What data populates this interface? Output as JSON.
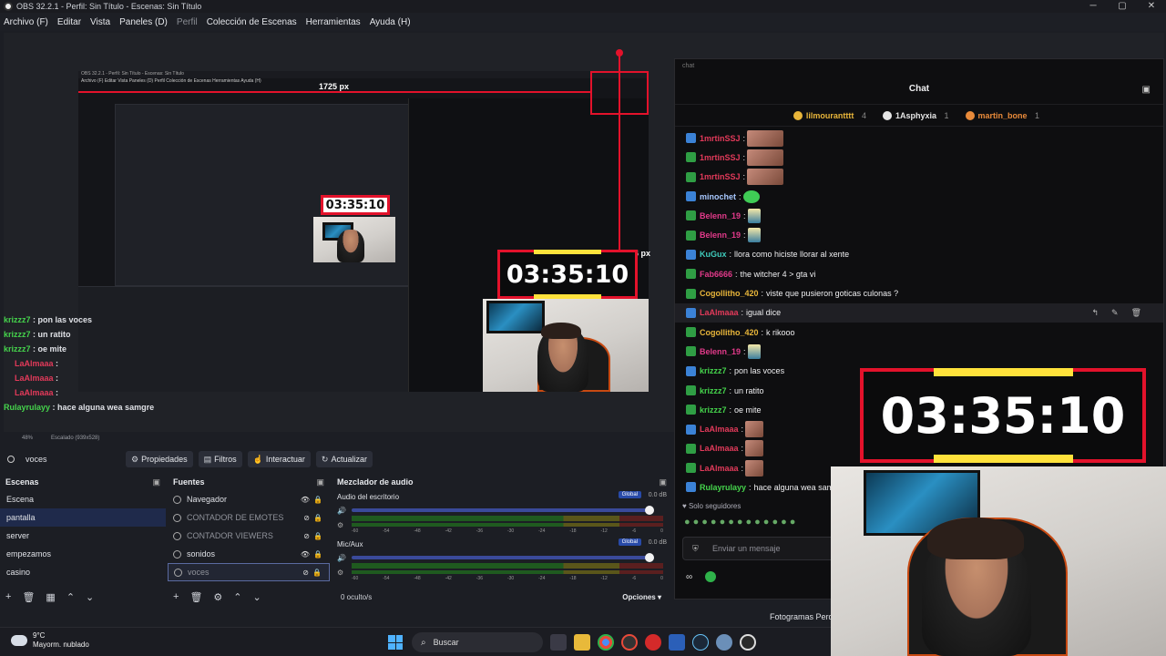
{
  "window": {
    "title": "OBS 32.2.1 - Perfil: Sin Título - Escenas: Sin Título",
    "min": "─",
    "max": "▢",
    "close": "✕"
  },
  "menu": [
    "Archivo (F)",
    "Editar",
    "Vista",
    "Paneles (D)",
    "Perfil",
    "Colección de Escenas",
    "Herramientas",
    "Ayuda (H)"
  ],
  "preview": {
    "width_label": "1725 px",
    "height_label": "934 px",
    "counter": "03:35:10",
    "zoom": "48%",
    "scaled": "Escalado (939x528)",
    "nested_title": "OBS 32.2.1 - Perfil: Sin Título - Escenas: Sin Título",
    "nested_menu": "Archivo (F)  Editar  Vista  Paneles (D)  Perfil  Colección de Escenas  Herramientas  Ayuda (H)",
    "overlay_chat": [
      {
        "user": "krizzz7",
        "text": " : pon las voces",
        "color": "#45d34c"
      },
      {
        "user": "krizzz7",
        "text": " : un ratito",
        "color": "#45d34c"
      },
      {
        "user": "krizzz7",
        "text": " : oe mite",
        "color": "#45d34c"
      },
      {
        "user": "LaAlmaaa",
        "text": " : ",
        "color": "#e23a5a"
      },
      {
        "user": "LaAlmaaa",
        "text": " : ",
        "color": "#e23a5a"
      },
      {
        "user": "LaAlmaaa",
        "text": " : ",
        "color": "#e23a5a"
      },
      {
        "user": "Rulayrulayy",
        "text": " : hace alguna wea samgre",
        "color": "#45d34c"
      }
    ]
  },
  "toolbar": {
    "source_name": "voces",
    "properties": "Propiedades",
    "filters": "Filtros",
    "interact": "Interactuar",
    "refresh": "Actualizar"
  },
  "scenes": {
    "title": "Escenas",
    "items": [
      "Escena",
      "pantalla",
      "server",
      "empezamos",
      "casino"
    ],
    "selected": 1
  },
  "sources": {
    "title": "Fuentes",
    "items": [
      {
        "name": "Navegador",
        "visible": true
      },
      {
        "name": "CONTADOR DE EMOTES",
        "visible": false
      },
      {
        "name": "CONTADOR VIEWERS",
        "visible": false
      },
      {
        "name": "sonidos",
        "visible": true
      },
      {
        "name": "voces",
        "visible": false
      }
    ]
  },
  "mixer": {
    "title": "Mezclador de audio",
    "channels": [
      {
        "name": "Audio del escritorio",
        "global": "Global",
        "db": "0.0 dB"
      },
      {
        "name": "Mic/Aux",
        "global": "Global",
        "db": "0.0 dB"
      }
    ],
    "ticks": [
      "-60",
      "-54",
      "-48",
      "-42",
      "-36",
      "-30",
      "-24",
      "-18",
      "-12",
      "-6",
      "0"
    ],
    "hidden": "0 oculto/s",
    "options": "Opciones"
  },
  "chat": {
    "panel_label": "chat",
    "title": "Chat",
    "leaders": [
      {
        "name": "lilmourantttt",
        "count": "4",
        "color": "#e8b53a"
      },
      {
        "name": "1Asphyxia",
        "count": "1",
        "color": "#e6e6e6"
      },
      {
        "name": "martin_bone",
        "count": "1",
        "color": "#e88a3a"
      }
    ],
    "messages": [
      {
        "user": "1mrtinSSJ",
        "text": "",
        "color": "#e23a5a",
        "emote": "big"
      },
      {
        "user": "1mrtinSSJ",
        "text": "",
        "color": "#e23a5a",
        "emote": "big"
      },
      {
        "user": "1mrtinSSJ",
        "text": "",
        "color": "#e23a5a",
        "emote": "big"
      },
      {
        "user": "minochet",
        "text": "",
        "color": "#a8c8ff",
        "emote": "green"
      },
      {
        "user": "Belenn_19",
        "text": "",
        "color": "#e23a8a",
        "emote": "cat"
      },
      {
        "user": "Belenn_19",
        "text": "",
        "color": "#e23a8a",
        "emote": "cat"
      },
      {
        "user": "KuGux",
        "text": "llora como hiciste llorar al xente",
        "color": "#3fcbbb",
        "emote": ""
      },
      {
        "user": "Fab6666",
        "text": "the witcher 4 > gta vi",
        "color": "#e23a8a",
        "emote": ""
      },
      {
        "user": "Cogollitho_420",
        "text": "viste que pusieron goticas culonas ?",
        "color": "#e8b53a",
        "emote": ""
      },
      {
        "user": "LaAlmaaa",
        "text": "igual dice",
        "color": "#e23a5a",
        "emote": ""
      },
      {
        "user": "Cogollitho_420",
        "text": "k rikooo",
        "color": "#e8b53a",
        "emote": ""
      },
      {
        "user": "Belenn_19",
        "text": "",
        "color": "#e23a8a",
        "emote": "cat"
      },
      {
        "user": "krizzz7",
        "text": "pon las voces",
        "color": "#45d34c",
        "emote": ""
      },
      {
        "user": "krizzz7",
        "text": "un ratito",
        "color": "#45d34c",
        "emote": ""
      },
      {
        "user": "krizzz7",
        "text": "oe mite",
        "color": "#45d34c",
        "emote": ""
      },
      {
        "user": "LaAlmaaa",
        "text": "",
        "color": "#e23a5a",
        "emote": "small"
      },
      {
        "user": "LaAlmaaa",
        "text": "",
        "color": "#e23a5a",
        "emote": "small"
      },
      {
        "user": "LaAlmaaa",
        "text": "",
        "color": "#e23a5a",
        "emote": "small"
      },
      {
        "user": "Rulayrulayy",
        "text": "hace alguna wea samgre",
        "color": "#45d34c",
        "emote": ""
      }
    ],
    "filter": "♥ Solo seguidores",
    "input_placeholder": "Enviar un mensaje",
    "footer": "∞"
  },
  "status": {
    "fps": "Fotogramas Perd"
  },
  "taskbar": {
    "temp": "9°C",
    "weather": "Mayorm. nublado",
    "search": "Buscar"
  }
}
